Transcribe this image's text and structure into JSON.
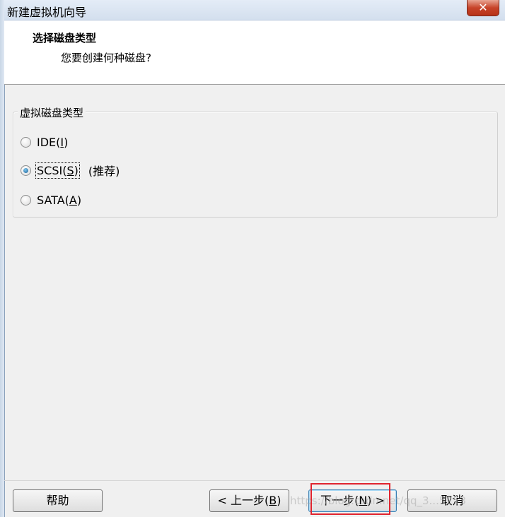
{
  "window": {
    "title": "新建虚拟机向导",
    "close_label": "✕"
  },
  "header": {
    "title": "选择磁盘类型",
    "subtitle": "您要创建何种磁盘?"
  },
  "group": {
    "legend": "虚拟磁盘类型",
    "options": [
      {
        "label_pre": "IDE(",
        "mnemonic": "I",
        "label_post": ")",
        "checked": false,
        "hint": ""
      },
      {
        "label_pre": "SCSI(",
        "mnemonic": "S",
        "label_post": ")",
        "checked": true,
        "hint": "(推荐)"
      },
      {
        "label_pre": "SATA(",
        "mnemonic": "A",
        "label_post": ")",
        "checked": false,
        "hint": ""
      }
    ]
  },
  "buttons": {
    "help": "帮助",
    "back_pre": "< 上一步(",
    "back_mn": "B",
    "back_post": ")",
    "next_pre": "下一步(",
    "next_mn": "N",
    "next_post": ") >",
    "cancel": "取消"
  },
  "watermark": "https://blog.csdn.net/qq_3...5253",
  "colors": {
    "annotation_box": "#e0242f",
    "close_button": "#c7442a"
  }
}
